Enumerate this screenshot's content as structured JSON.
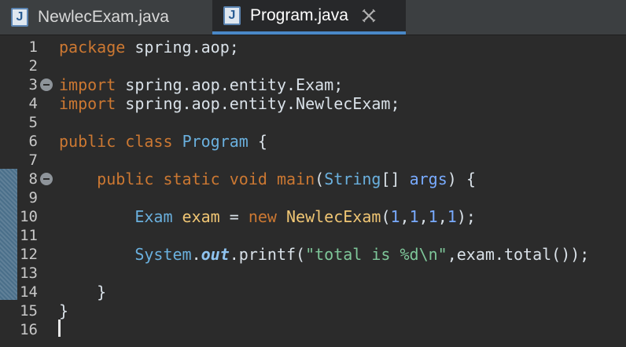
{
  "tabs": [
    {
      "label": "NewlecExam.java",
      "icon": "java-file-icon",
      "active": false
    },
    {
      "label": "Program.java",
      "icon": "java-file-icon",
      "active": true
    }
  ],
  "icon_letter": "J",
  "colors": {
    "accent": "#4a88c7",
    "keyword": "#cc7832",
    "string": "#7ec699",
    "type": "#6ab0de"
  },
  "lines": [
    {
      "n": "1",
      "tokens": [
        [
          "kw",
          "package"
        ],
        [
          "plain",
          " spring.aop;"
        ]
      ]
    },
    {
      "n": "2",
      "tokens": []
    },
    {
      "n": "3",
      "fold": true,
      "tokens": [
        [
          "kw",
          "import"
        ],
        [
          "plain",
          " spring.aop.entity.Exam;"
        ]
      ]
    },
    {
      "n": "4",
      "tokens": [
        [
          "kw",
          "import"
        ],
        [
          "plain",
          " spring.aop.entity.NewlecExam;"
        ]
      ]
    },
    {
      "n": "5",
      "tokens": []
    },
    {
      "n": "6",
      "tokens": [
        [
          "kw",
          "public"
        ],
        [
          "plain",
          " "
        ],
        [
          "kw",
          "class"
        ],
        [
          "plain",
          " "
        ],
        [
          "type",
          "Program"
        ],
        [
          "plain",
          " {"
        ]
      ]
    },
    {
      "n": "7",
      "tokens": []
    },
    {
      "n": "8",
      "fold": true,
      "tokens": [
        [
          "plain",
          "    "
        ],
        [
          "kw",
          "public"
        ],
        [
          "plain",
          " "
        ],
        [
          "kw",
          "static"
        ],
        [
          "plain",
          " "
        ],
        [
          "kw",
          "void"
        ],
        [
          "plain",
          " "
        ],
        [
          "kw",
          "main"
        ],
        [
          "plain",
          "("
        ],
        [
          "type",
          "String"
        ],
        [
          "plain",
          "[] "
        ],
        [
          "param",
          "args"
        ],
        [
          "plain",
          ") {"
        ]
      ]
    },
    {
      "n": "9",
      "tokens": []
    },
    {
      "n": "10",
      "tokens": [
        [
          "plain",
          "        "
        ],
        [
          "type",
          "Exam"
        ],
        [
          "plain",
          " "
        ],
        [
          "local",
          "exam"
        ],
        [
          "plain",
          " = "
        ],
        [
          "kw",
          "new"
        ],
        [
          "plain",
          " "
        ],
        [
          "local",
          "NewlecExam"
        ],
        [
          "plain",
          "("
        ],
        [
          "param",
          "1"
        ],
        [
          "plain",
          ","
        ],
        [
          "param",
          "1"
        ],
        [
          "plain",
          ","
        ],
        [
          "param",
          "1"
        ],
        [
          "plain",
          ","
        ],
        [
          "param",
          "1"
        ],
        [
          "plain",
          ");"
        ]
      ]
    },
    {
      "n": "11",
      "tokens": []
    },
    {
      "n": "12",
      "tokens": [
        [
          "plain",
          "        "
        ],
        [
          "type",
          "System"
        ],
        [
          "plain",
          "."
        ],
        [
          "field",
          "out"
        ],
        [
          "plain",
          ".printf("
        ],
        [
          "str",
          "\"total is %d\\n\""
        ],
        [
          "plain",
          ",exam.total());"
        ]
      ]
    },
    {
      "n": "13",
      "tokens": []
    },
    {
      "n": "14",
      "tokens": [
        [
          "plain",
          "    }"
        ]
      ]
    },
    {
      "n": "15",
      "tokens": [
        [
          "plain",
          "}"
        ]
      ]
    },
    {
      "n": "16",
      "tokens": []
    }
  ]
}
